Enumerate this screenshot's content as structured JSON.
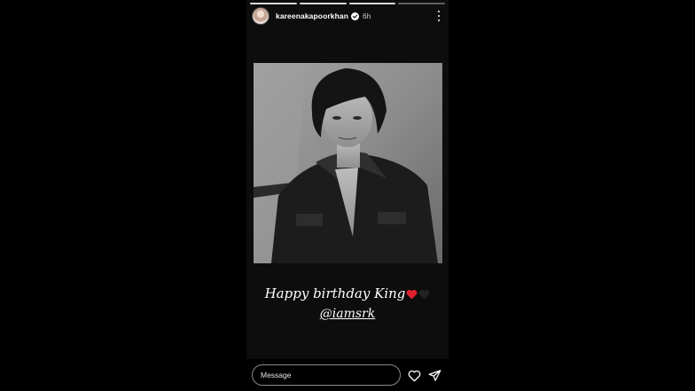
{
  "story": {
    "progress_segments": 4,
    "username": "kareenakapoorkhan",
    "time_ago": "6h",
    "verified": true,
    "caption_line1": "Happy birthday King",
    "caption_mention": "@iamsrk",
    "emoji": [
      "red-heart",
      "black-heart"
    ]
  },
  "reply": {
    "placeholder": "Message"
  },
  "colors": {
    "background": "#000000",
    "verified_blue": "#3897f0",
    "heart_red": "#e0202f"
  }
}
